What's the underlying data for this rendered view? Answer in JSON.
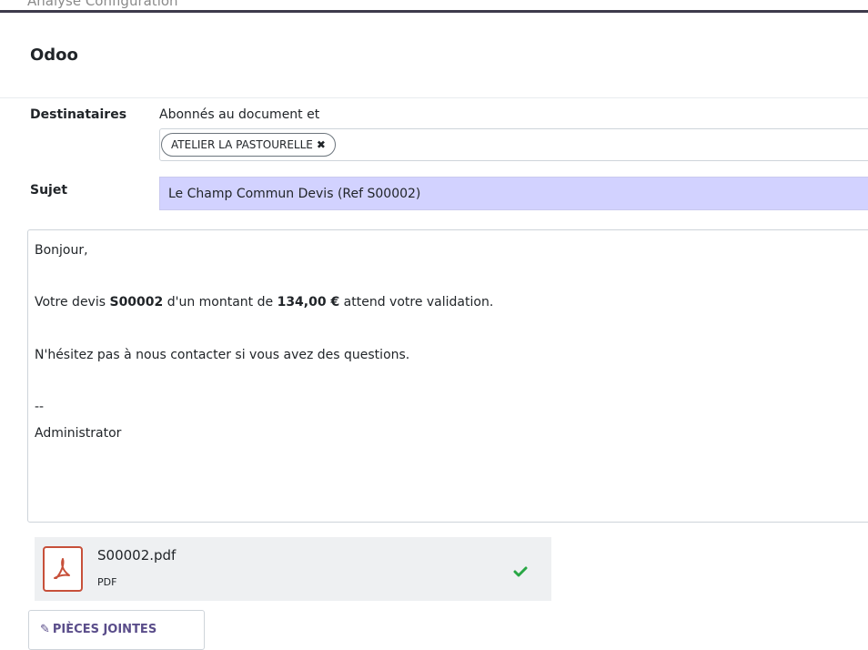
{
  "topbar": {
    "ghost_text": "Analyse     Configuration"
  },
  "modal": {
    "title": "Odoo"
  },
  "recipients": {
    "label": "Destinataires",
    "followers_text": "Abonnés au document et",
    "tags": [
      {
        "label": "ATELIER LA PASTOURELLE",
        "remove_icon": "close-icon"
      }
    ]
  },
  "subject": {
    "label": "Sujet",
    "value": "Le Champ Commun Devis (Ref S00002)"
  },
  "body": {
    "greeting": "Bonjour,",
    "line2": {
      "part1": "Votre devis ",
      "ref": "S00002",
      "part2": " d'un montant de ",
      "amount": "134,00 €",
      "part3": " attend votre validation."
    },
    "line3": "N'hésitez pas à nous contacter si vous avez des questions.",
    "signature_sep": "--",
    "signature_name": "Administrator"
  },
  "attachment": {
    "name": "S00002.pdf",
    "type": "PDF",
    "icon": "pdf-icon",
    "status_icon": "check-icon",
    "status_color": "#28a745"
  },
  "attach_button": {
    "icon": "paperclip-icon",
    "label": "PIÈCES JOINTES"
  },
  "colors": {
    "accent": "#5a4d8a",
    "subject_bg": "#d2d2ff",
    "pdf_red": "#c7503a"
  }
}
